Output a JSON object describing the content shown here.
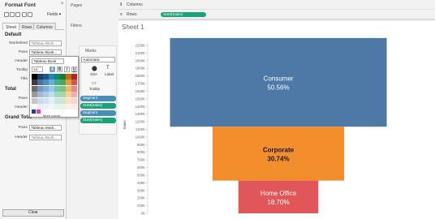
{
  "format_pane": {
    "title": "Format Font",
    "close": "×",
    "fields_label": "Fields ▾",
    "tabs": [
      "Sheet",
      "Rows",
      "Columns"
    ],
    "default_section": "Default",
    "worksheet_label": "Worksheet",
    "worksheet_value": "Tableau Book...",
    "pane_label": "Pane",
    "pane_value": "Tableau Book...",
    "header_label": "Header",
    "header_value": "Tableau Book",
    "tooltip_label": "Tooltip",
    "title_label": "Title",
    "total_section": "Total",
    "total_pane_label": "Pane",
    "total_header_label": "Header",
    "grand_total_section": "Grand Total",
    "gt_pane_label": "Pane",
    "gt_pane_value": "Tableau Medi...",
    "gt_header_label": "Header",
    "gt_header_value": "Tableau Book...",
    "clear_label": "Clear"
  },
  "font_popup": {
    "size": "14",
    "bold": "B",
    "italic": "I",
    "underline": "U",
    "more_colors": "More colors...",
    "swatches": [
      "#000000",
      "#1f3b66",
      "#1a5a8a",
      "#2e7fb8",
      "#0d8a6a",
      "#1f7a2e",
      "#c46a12",
      "#b0271f",
      "#3d3d3d",
      "#4a6fa5",
      "#4f8fc0",
      "#6aaed6",
      "#3fae8c",
      "#4ea84e",
      "#e89a3c",
      "#d2584f",
      "#6b6b6b",
      "#7a95c2",
      "#7fb0d6",
      "#9bc8e6",
      "#6fc6a8",
      "#7dc27b",
      "#f2b66a",
      "#e48a82",
      "#9a9a9a",
      "#a6b8d8",
      "#a9cbe6",
      "#c2ddf0",
      "#9dd8c0",
      "#a8d7a5",
      "#f7cf97",
      "#f0b2ac",
      "#c4c4c4",
      "#cdd8ea",
      "#cfe2f1",
      "#dfeef8",
      "#c6e9da",
      "#cfe8cd",
      "#fbe3c2",
      "#f7d6d2",
      "#ffffff",
      "#e9eef6",
      "#e8f1f8",
      "#f0f7fc",
      "#e4f5ec",
      "#e8f4e7",
      "#fdf1e2",
      "#fbeae8"
    ],
    "recent": [
      "#1f3b9a",
      "#e03bd6"
    ]
  },
  "middle": {
    "pages": "Pages",
    "filters": "Filters",
    "marks": "Marks",
    "marks_type": "Automatic",
    "size_label": "Size",
    "label_label": "Label",
    "tooltip_label": "Tooltip",
    "pills": [
      "Segment",
      "SUM(Sales)",
      "Segment",
      "SUM(Sales)"
    ]
  },
  "shelves": {
    "columns": "Columns",
    "rows": "Rows",
    "rows_pill": "SUM(Sales)"
  },
  "viz": {
    "sheet_title": "Sheet 1",
    "ylabel": "Sales"
  },
  "chart_data": {
    "type": "bar",
    "title": "Sheet 1",
    "ylabel": "Sales",
    "y_ticks": [
      "0K",
      "100K",
      "200K",
      "300K",
      "400K",
      "500K",
      "600K",
      "700K",
      "800K",
      "900K",
      "1000K",
      "1100K",
      "1200K",
      "1300K",
      "1400K",
      "1500K",
      "1600K",
      "1700K",
      "1800K",
      "1900K",
      "2000K",
      "2100K",
      "2200K"
    ],
    "ylim": [
      0,
      2200000
    ],
    "series": [
      {
        "name": "Consumer",
        "label": "Consumer\n50.56%",
        "pct": "50.56%",
        "y_start": 1135000,
        "y_end": 2297000,
        "color": "#4e79a7"
      },
      {
        "name": "Corporate",
        "label": "Corporate\n30.74%",
        "pct": "30.74%",
        "y_start": 429000,
        "y_end": 1135000,
        "color": "#f28e2b"
      },
      {
        "name": "Home Office",
        "label": "Home Office\n18.70%",
        "pct": "18.70%",
        "y_start": 0,
        "y_end": 429000,
        "color": "#e15759"
      }
    ]
  }
}
